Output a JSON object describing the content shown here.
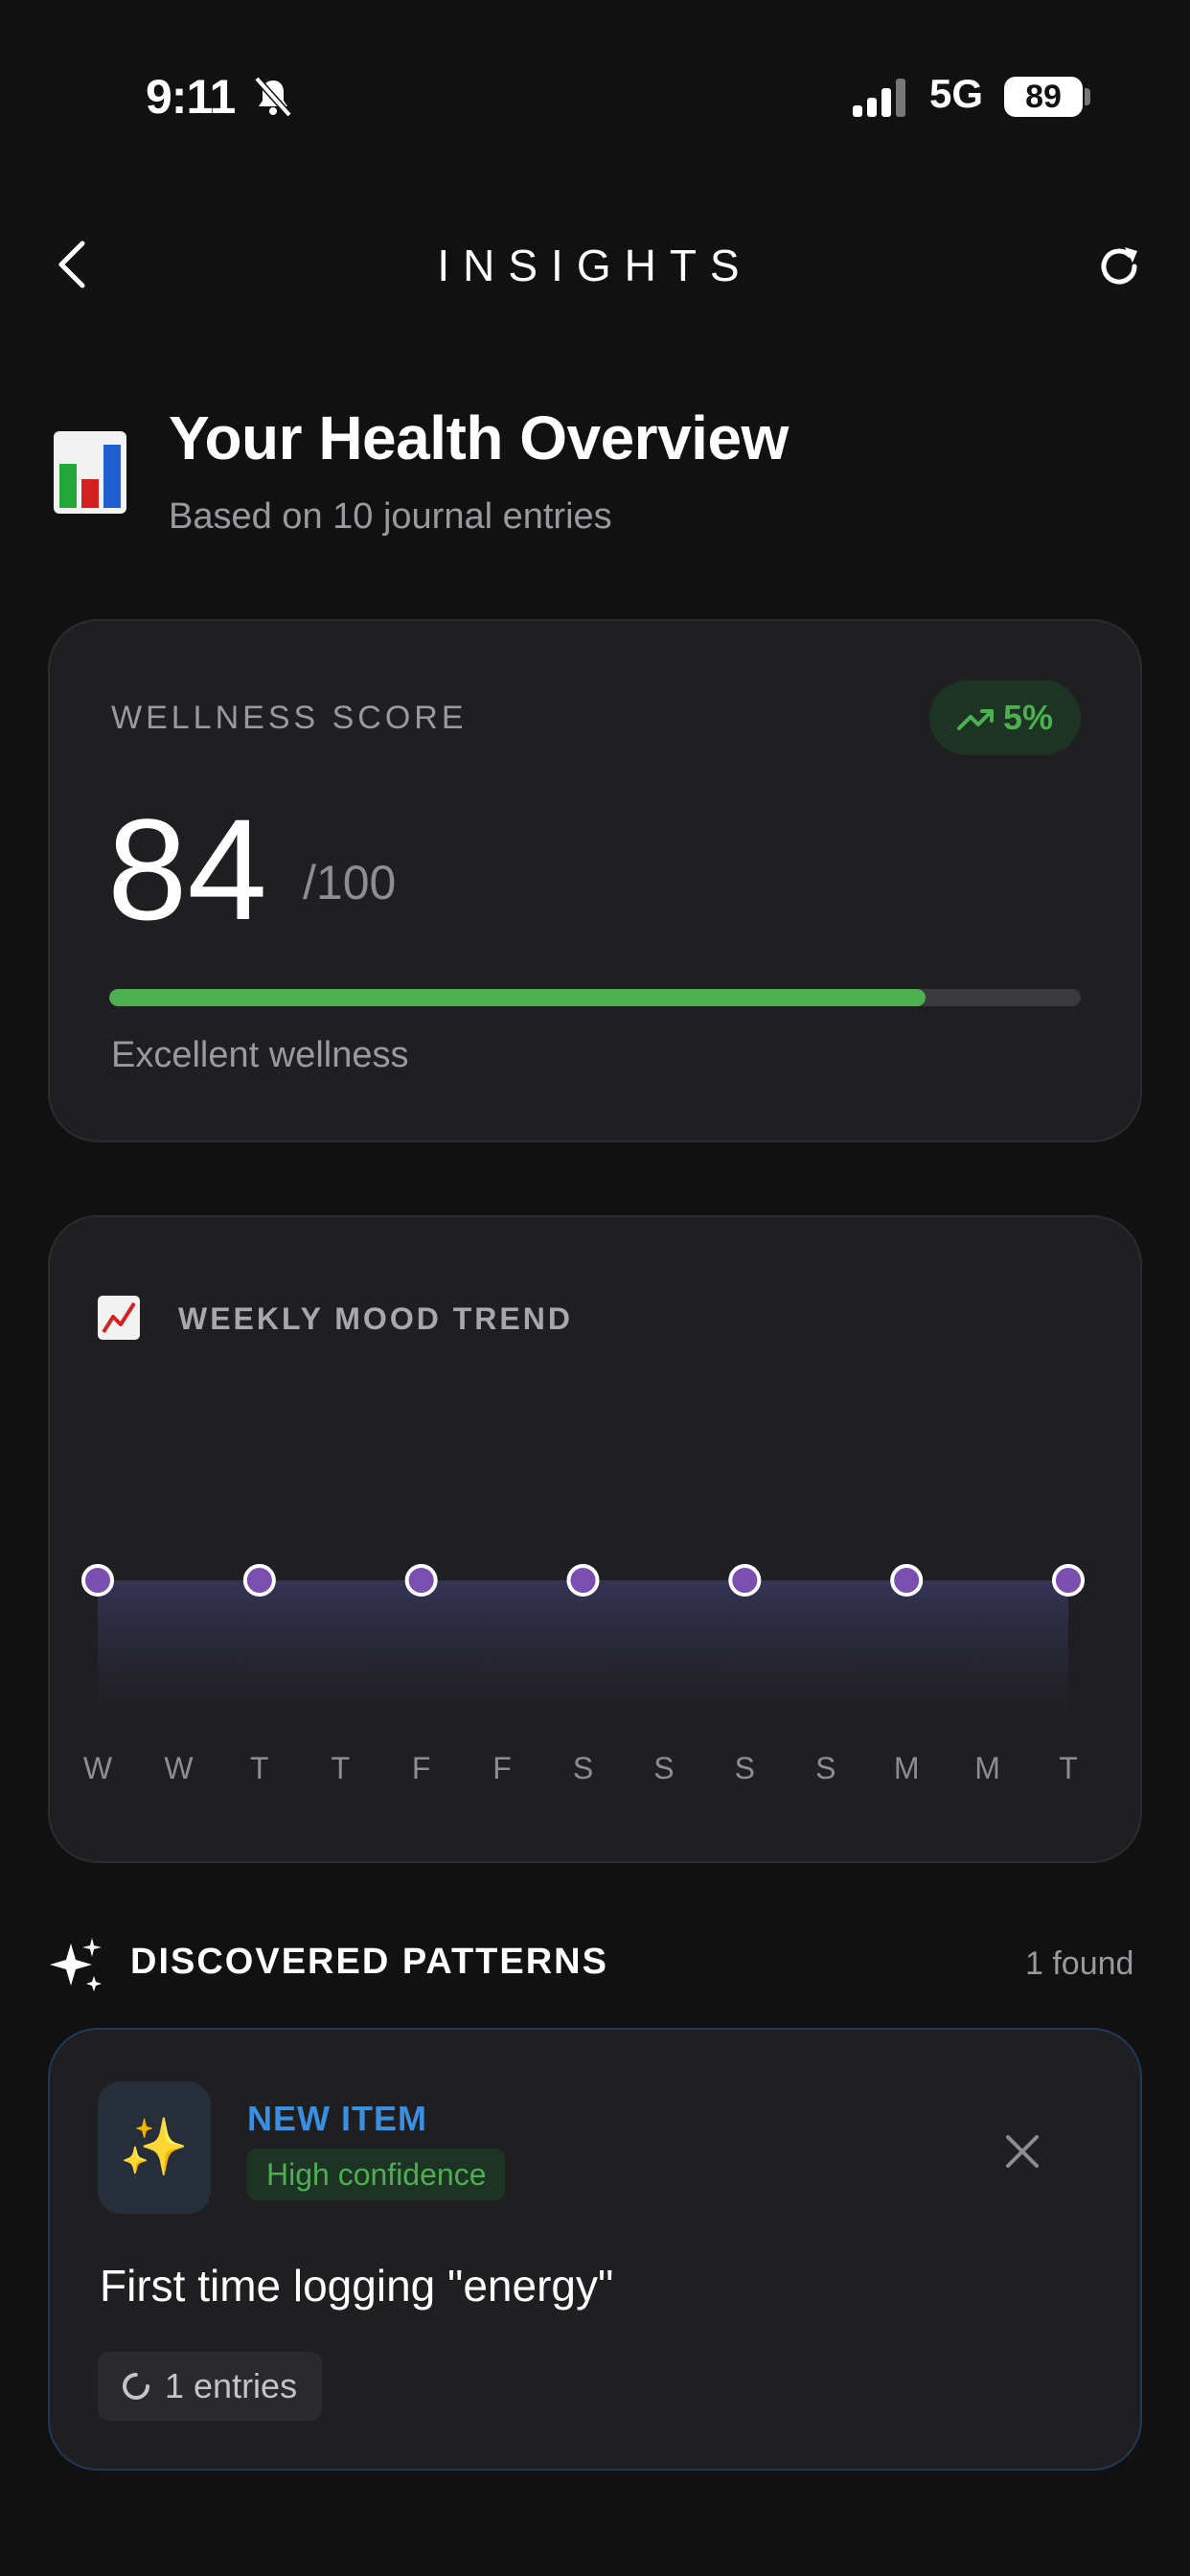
{
  "status_bar": {
    "time": "9:11",
    "network": "5G",
    "battery": "89"
  },
  "header": {
    "title": "INSIGHTS",
    "back_icon": "chevron-left-icon",
    "refresh_icon": "refresh-icon"
  },
  "overview": {
    "icon": "bar-chart-icon",
    "title": "Your Health Overview",
    "subtitle": "Based on 10 journal entries"
  },
  "wellness": {
    "label": "WELLNESS SCORE",
    "trend": "5%",
    "score": "84",
    "max": "/100",
    "progress": 0.84,
    "status": "Excellent wellness",
    "accent": "#4caf50"
  },
  "mood": {
    "label": "WEEKLY MOOD TREND",
    "icon": "line-chart-icon",
    "chart_data": {
      "type": "area",
      "x": [
        "W",
        "W",
        "T",
        "T",
        "F",
        "F",
        "S",
        "S",
        "S",
        "S",
        "M",
        "M",
        "T"
      ],
      "points_at": [
        0,
        2,
        4,
        6,
        8,
        10,
        12
      ],
      "values": [
        5,
        5,
        5,
        5,
        5,
        5,
        5
      ],
      "line_gradient": [
        "#6b7cf0",
        "#9b59b6"
      ]
    }
  },
  "patterns": {
    "title": "DISCOVERED PATTERNS",
    "count": "1 found",
    "items": [
      {
        "type": "NEW ITEM",
        "confidence": "High confidence",
        "text": "First time logging \"energy\"",
        "entries": "1 entries"
      }
    ]
  }
}
